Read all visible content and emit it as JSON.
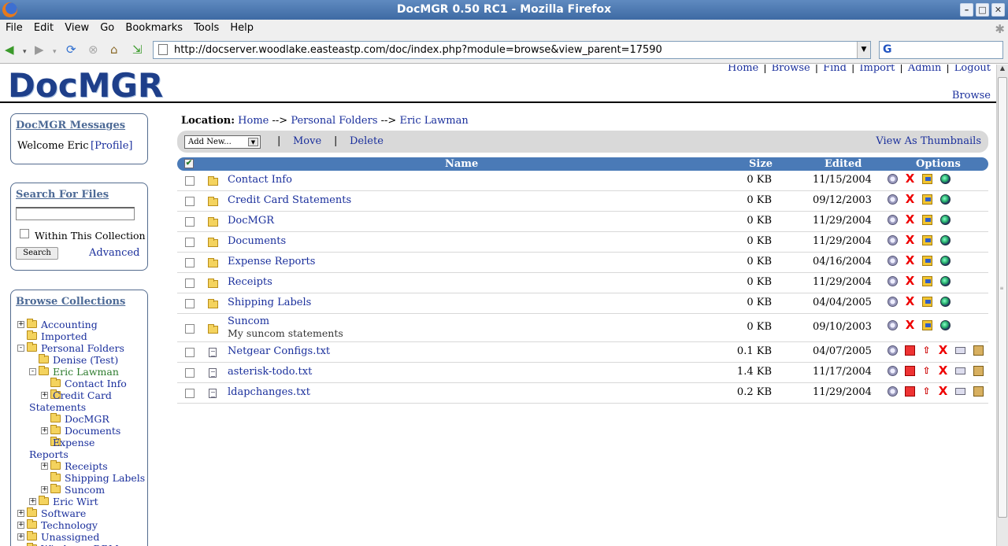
{
  "window": {
    "title": "DocMGR 0.50 RC1 - Mozilla Firefox"
  },
  "menu": [
    "File",
    "Edit",
    "View",
    "Go",
    "Bookmarks",
    "Tools",
    "Help"
  ],
  "nav": {
    "url": "http://docserver.woodlake.easteastp.com/doc/index.php?module=browse&view_parent=17590"
  },
  "header": {
    "logo": "DocMGR",
    "links": [
      "Home",
      "Browse",
      "Find",
      "Import",
      "Admin",
      "Logout"
    ],
    "current_module": "Browse"
  },
  "messages": {
    "title": "DocMGR Messages",
    "welcome": "Welcome Eric",
    "profile_link": "[Profile]"
  },
  "search": {
    "title": "Search For Files",
    "value": "",
    "within_label": "Within This Collection",
    "button": "Search",
    "advanced": "Advanced"
  },
  "collections": {
    "title": "Browse Collections",
    "items": [
      {
        "label": "Accounting",
        "level": 0,
        "expander": "+"
      },
      {
        "label": "Imported",
        "level": 0,
        "expander": ""
      },
      {
        "label": "Personal Folders",
        "level": 0,
        "expander": "-"
      },
      {
        "label": "Denise (Test)",
        "level": 1,
        "expander": ""
      },
      {
        "label": "Eric Lawman",
        "level": 1,
        "expander": "-",
        "current": true
      },
      {
        "label": "Contact Info",
        "level": 2,
        "expander": ""
      },
      {
        "label": "Credit Card Statements",
        "level": 2,
        "expander": "+"
      },
      {
        "label": "DocMGR",
        "level": 2,
        "expander": ""
      },
      {
        "label": "Documents",
        "level": 2,
        "expander": "+"
      },
      {
        "label": "Expense Reports",
        "level": 2,
        "expander": ""
      },
      {
        "label": "Receipts",
        "level": 2,
        "expander": "+"
      },
      {
        "label": "Shipping Labels",
        "level": 2,
        "expander": ""
      },
      {
        "label": "Suncom",
        "level": 2,
        "expander": "+"
      },
      {
        "label": "Eric Wirt",
        "level": 1,
        "expander": "+"
      },
      {
        "label": "Software",
        "level": 0,
        "expander": "+"
      },
      {
        "label": "Technology",
        "level": 0,
        "expander": "+"
      },
      {
        "label": "Unassigned",
        "level": 0,
        "expander": "+"
      },
      {
        "label": "Windsong DBM",
        "level": 0,
        "expander": ""
      }
    ]
  },
  "location": {
    "label": "Location:",
    "crumbs": [
      "Home",
      "Personal Folders",
      "Eric Lawman"
    ],
    "sep": "-->"
  },
  "toolbar": {
    "add_new": "Add New...",
    "move": "Move",
    "delete": "Delete",
    "thumbnails": "View As Thumbnails"
  },
  "table": {
    "headers": {
      "name": "Name",
      "size": "Size",
      "edited": "Edited",
      "options": "Options"
    },
    "rows": [
      {
        "type": "folder",
        "name": "Contact Info",
        "sub": "",
        "size": "0 KB",
        "edited": "11/15/2004"
      },
      {
        "type": "folder",
        "name": "Credit Card Statements",
        "sub": "",
        "size": "0 KB",
        "edited": "09/12/2003"
      },
      {
        "type": "folder",
        "name": "DocMGR",
        "sub": "",
        "size": "0 KB",
        "edited": "11/29/2004"
      },
      {
        "type": "folder",
        "name": "Documents",
        "sub": "",
        "size": "0 KB",
        "edited": "11/29/2004"
      },
      {
        "type": "folder",
        "name": "Expense Reports",
        "sub": "",
        "size": "0 KB",
        "edited": "04/16/2004"
      },
      {
        "type": "folder",
        "name": "Receipts",
        "sub": "",
        "size": "0 KB",
        "edited": "11/29/2004"
      },
      {
        "type": "folder",
        "name": "Shipping Labels",
        "sub": "",
        "size": "0 KB",
        "edited": "04/04/2005"
      },
      {
        "type": "folder",
        "name": "Suncom",
        "sub": "My suncom statements",
        "size": "0 KB",
        "edited": "09/10/2003"
      },
      {
        "type": "file",
        "name": "Netgear Configs.txt",
        "sub": "",
        "size": "0.1 KB",
        "edited": "04/07/2005"
      },
      {
        "type": "file",
        "name": "asterisk-todo.txt",
        "sub": "",
        "size": "1.4 KB",
        "edited": "11/17/2004"
      },
      {
        "type": "file",
        "name": "ldapchanges.txt",
        "sub": "",
        "size": "0.2 KB",
        "edited": "11/29/2004"
      }
    ]
  },
  "colors": {
    "accent": "#4a7ab7",
    "link": "#1a2f9c",
    "box_title": "#4d6a96",
    "current_tree": "#2b7a2b"
  }
}
